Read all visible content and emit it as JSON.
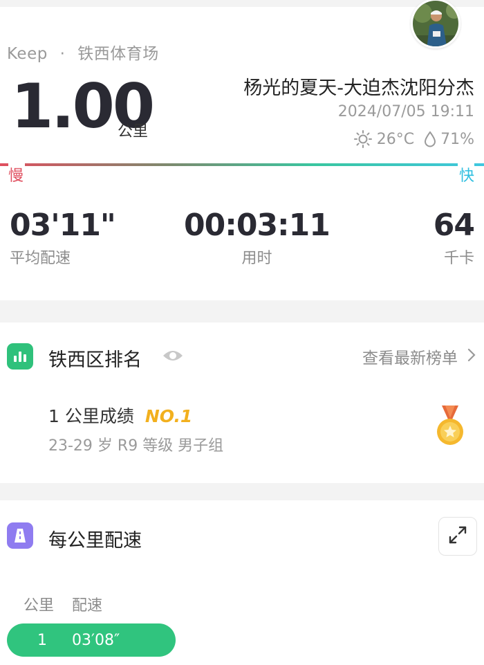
{
  "header": {
    "brand": "Keep",
    "separator": "·",
    "location": "铁西体育场",
    "distance_value": "1.00",
    "distance_unit": "公里",
    "event_name": "杨光的夏天-大迫杰沈阳分杰",
    "datetime": "2024/07/05 19:11",
    "temperature": "26°C",
    "humidity": "71%",
    "weather_icon": "sun-icon",
    "humidity_icon": "droplet-icon"
  },
  "pace_scale": {
    "slow_label": "慢",
    "fast_label": "快",
    "colors": {
      "slow": "#e04f5f",
      "fast": "#3fc7e0"
    }
  },
  "stats": [
    {
      "value": "03'11\"",
      "label": "平均配速"
    },
    {
      "value": "00:03:11",
      "label": "用时"
    },
    {
      "value": "64",
      "label": "千卡"
    }
  ],
  "ranking": {
    "title": "铁西区排名",
    "link_label": "查看最新榜单",
    "result_prefix": "1 公里成绩",
    "rank": "NO.1",
    "detail": "23-29 岁 R9 等级 男子组",
    "icon": "bar-chart-icon",
    "accent": "#f2b01e"
  },
  "pace_section": {
    "title": "每公里配速",
    "col_km": "公里",
    "col_pace": "配速",
    "rows": [
      {
        "km": "1",
        "pace": "03′08″"
      }
    ],
    "row_color": "#30c47e"
  }
}
